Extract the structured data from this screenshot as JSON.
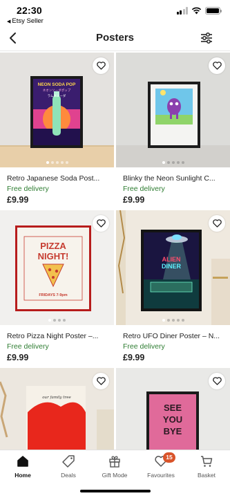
{
  "status": {
    "time": "22:30",
    "back_app": "Etsy Seller"
  },
  "header": {
    "title": "Posters"
  },
  "products": [
    {
      "title": "Retro Japanese Soda Post...",
      "delivery": "Free delivery",
      "price": "£9.99",
      "poster_line1": "NEON SODA POP",
      "poster_line2": "ネオンソーダポップ",
      "poster_line3": "ラムネソーダ"
    },
    {
      "title": "Blinky the Neon Sunlight C...",
      "delivery": "Free delivery",
      "price": "£9.99"
    },
    {
      "title": "Retro Pizza Night Poster –...",
      "delivery": "Free delivery",
      "price": "£9.99",
      "poster_line1": "PIZZA",
      "poster_line2": "NIGHT!",
      "poster_line3": "FRIDAYS 7-9pm"
    },
    {
      "title": "Retro UFO Diner Poster – N...",
      "delivery": "Free delivery",
      "price": "£9.99",
      "poster_line1": "ALIEN",
      "poster_line2": "DINER"
    },
    {
      "poster_line1": "our family tree"
    },
    {
      "poster_line1": "SEE",
      "poster_line2": "YOU",
      "poster_line3": "BYE"
    }
  ],
  "nav": {
    "items": [
      {
        "label": "Home",
        "icon": "home-icon",
        "active": true
      },
      {
        "label": "Deals",
        "icon": "tag-icon"
      },
      {
        "label": "Gift Mode",
        "icon": "gift-icon"
      },
      {
        "label": "Favourites",
        "icon": "heart-icon",
        "badge": "15"
      },
      {
        "label": "Basket",
        "icon": "basket-icon"
      }
    ]
  },
  "colors": {
    "accent": "#d9542a",
    "delivery": "#2e7d32"
  }
}
